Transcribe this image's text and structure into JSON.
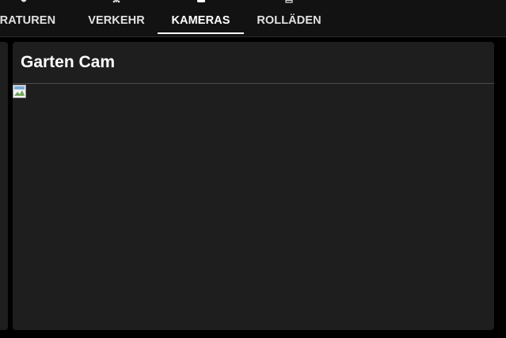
{
  "tabs": [
    {
      "label": "ERATUREN",
      "icon": "thermometer-icon",
      "active": false
    },
    {
      "label": "VERKEHR",
      "icon": "car-icon",
      "active": false
    },
    {
      "label": "KAMERAS",
      "icon": "camera-icon",
      "active": true
    },
    {
      "label": "ROLLÄDEN",
      "icon": "window-shutter-icon",
      "active": false
    }
  ],
  "card": {
    "title": "Garten Cam",
    "image_icon": "broken-image-icon"
  },
  "colors": {
    "background": "#000000",
    "tabbar": "#121212",
    "card": "#1e1e1e",
    "text": "#ffffff",
    "tab_text": "#e1e1e1",
    "divider": "#4a4a4a"
  }
}
